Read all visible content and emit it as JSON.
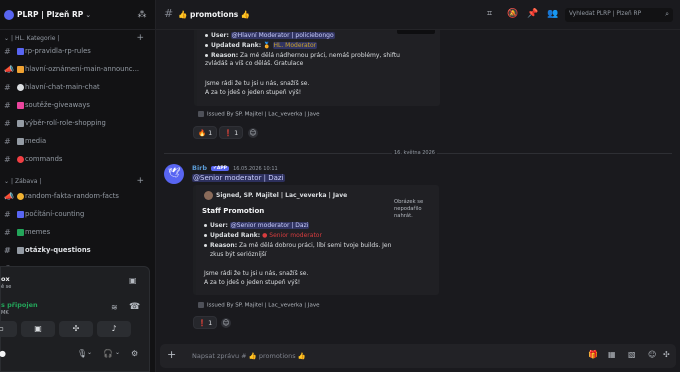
{
  "server": {
    "name": "PLRP | Plzeň RP",
    "chevron": "⌄"
  },
  "categories": [
    {
      "label": "| HL. Kategorie |"
    },
    {
      "label": "| Zábava |"
    }
  ],
  "channels": [
    {
      "name": "rp-pravidla-rp-rules",
      "icon_color": "#5865f2"
    },
    {
      "name": "hlavní-oznámení-main-announc...",
      "icon_color": "#f0a232"
    },
    {
      "name": "hlavní-chat-main-chat",
      "icon_color": "#dbdee1"
    },
    {
      "name": "soutěže-giveaways",
      "icon_color": "#eb459e"
    },
    {
      "name": "výběr-rolí-role-shopping",
      "icon_color": "#949ba4"
    },
    {
      "name": "media",
      "icon_color": "#949ba4"
    },
    {
      "name": "commands",
      "icon_color": "#f23f43"
    },
    {
      "name": "random-fakta-random-facts",
      "icon_color": "#f0b232"
    },
    {
      "name": "počítání-counting",
      "icon_color": "#5865f2"
    },
    {
      "name": "memes",
      "icon_color": "#23a55a"
    },
    {
      "name": "otázky-questions",
      "icon_color": "#949ba4"
    },
    {
      "name": "",
      "icon_color": "#949ba4"
    }
  ],
  "user_panel": {
    "name": "ox",
    "sub": "ě se",
    "voice_status": "s připojen",
    "voice_sub": "MK"
  },
  "topbar": {
    "channel": "promotions",
    "search_placeholder": "Vyhledat PLRP | Plzeň RP"
  },
  "messages": {
    "first_embed": {
      "user_label": "User:",
      "user_value": "@Hlavní Moderator | policiebongo",
      "rank_label": "Updated Rank:",
      "rank_value": "HL. Moderator",
      "reason_label": "Reason:",
      "reason_value": "Za mé dělá nádhernou práci, nemáš problémy, shiftu zvládáš a víš co děláš. Gratulace",
      "closing_1": "Jsme rádi že tu jsi u nás, snažíš se.",
      "closing_2": "A za to jdeš o jeden stupeň výš!",
      "footer": "Issued By SP. Majitel | Lac_veverka | Jave",
      "reactions": [
        {
          "emoji": "🔥",
          "count": "1"
        },
        {
          "emoji": "❗",
          "count": "1"
        }
      ]
    },
    "date_divider": "16. května 2026",
    "second": {
      "author": "Birb",
      "app_tag": "✔APP",
      "time": "16.05.2026 10:11",
      "mention": "@Senior moderator | Dazi",
      "signer": "Signed, SP. Majitel | Lac_veverka | Jave",
      "title": "Staff Promotion",
      "user_label": "User:",
      "user_value": "@Senior moderator | Dazi",
      "rank_label": "Updated Rank:",
      "rank_value": "Senior moderator",
      "reason_label": "Reason:",
      "reason_value_1": "Za mě dělá dobrou práci, líbí semi tvoje builds. Jen",
      "reason_value_2": "zkus být seriózníjší",
      "closing_1": "Jsme rádi že tu jsi u nás, snažíš se.",
      "closing_2": "A za to jdeš o jeden stupeň výš!",
      "footer": "Issued By SP. Majitel | Lac_veverka | Jave",
      "image_alt": "Obrázek se nepodařilo nahrát.",
      "reactions": [
        {
          "emoji": "❗",
          "count": "1"
        }
      ]
    }
  },
  "composer": {
    "placeholder": "Napsat zprávu # 👍 promotions 👍"
  }
}
